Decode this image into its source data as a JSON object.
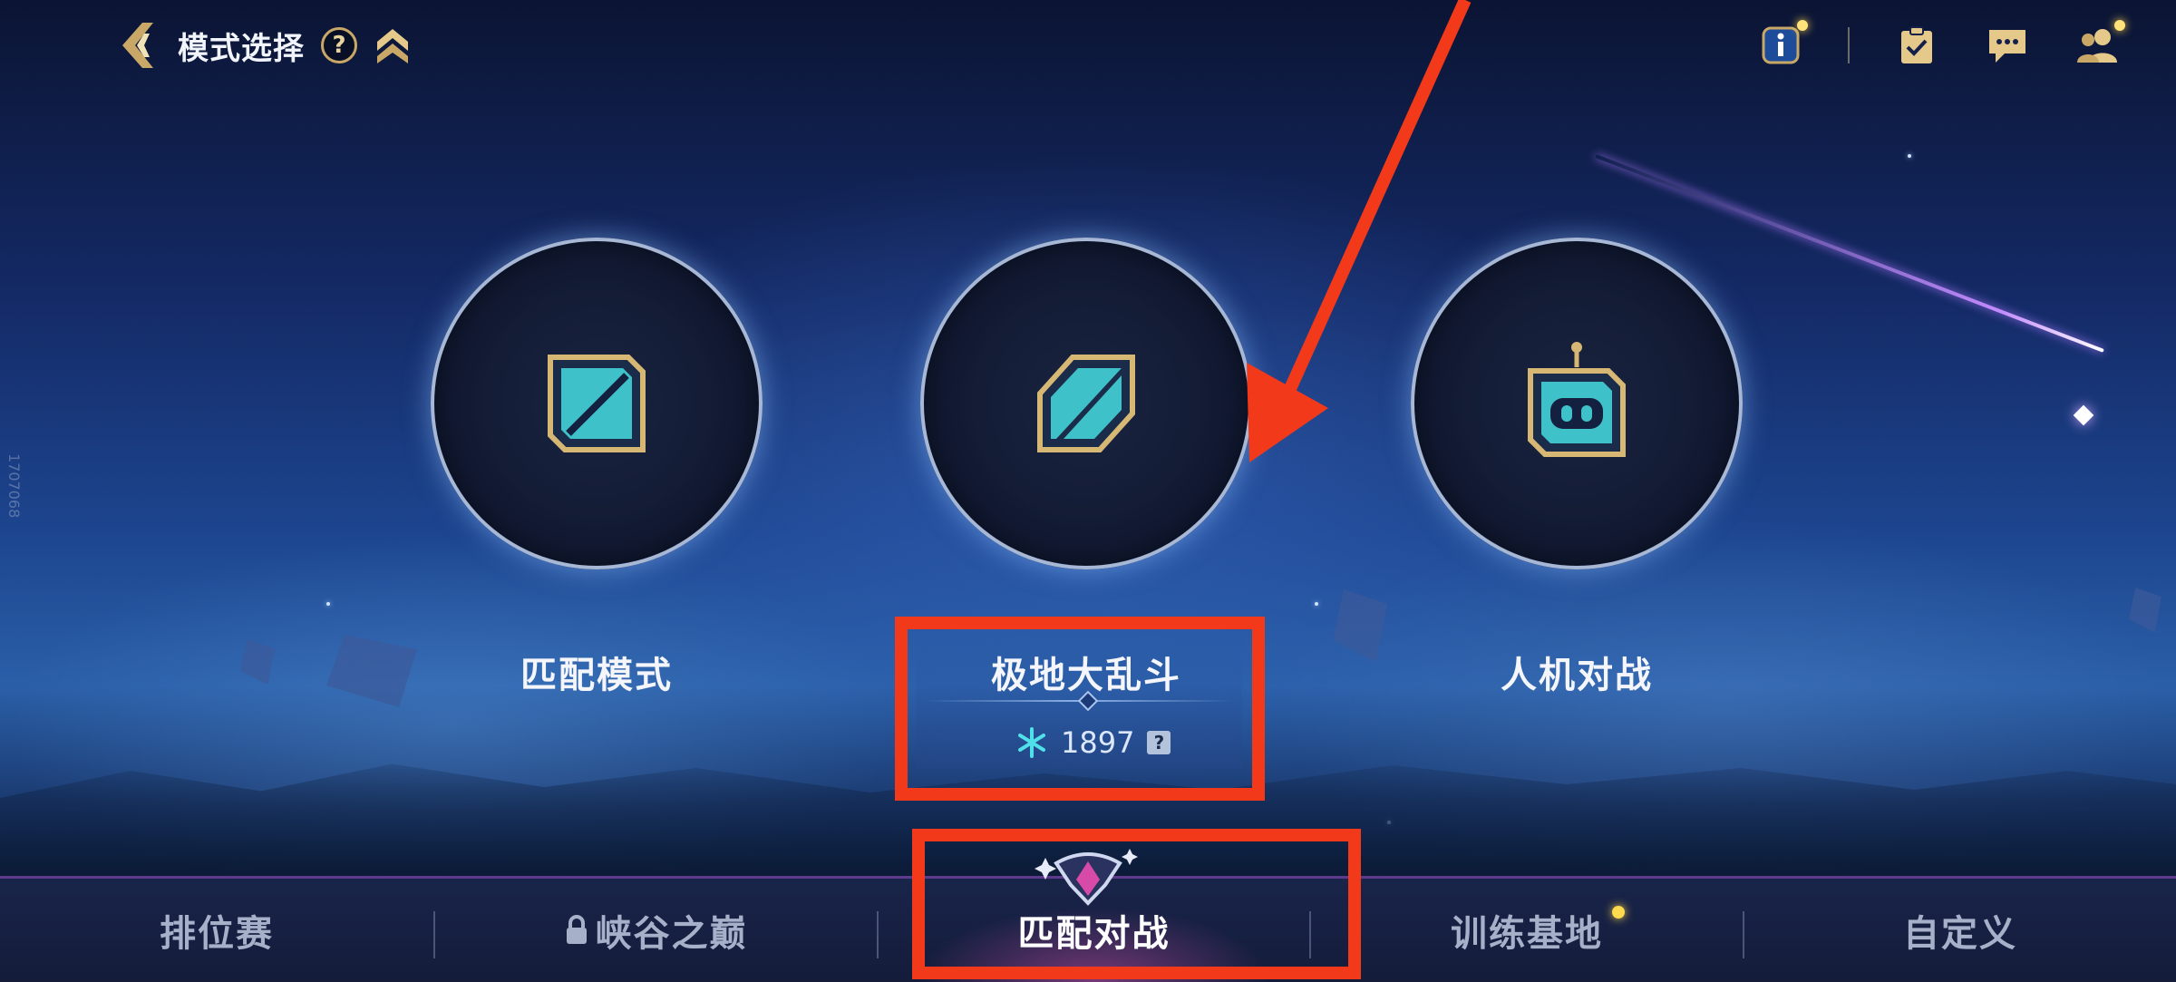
{
  "header": {
    "title": "模式选择",
    "help": "?"
  },
  "side_mark": "1707068",
  "modes": [
    {
      "label": "匹配模式"
    },
    {
      "label": "极地大乱斗"
    },
    {
      "label": "人机对战"
    }
  ],
  "aram_detail": {
    "points": "1897",
    "help": "?"
  },
  "tabs": [
    {
      "label": "排位赛"
    },
    {
      "label": "峡谷之巅"
    },
    {
      "label": "匹配对战"
    },
    {
      "label": "训练基地"
    },
    {
      "label": "自定义"
    }
  ],
  "colors": {
    "accent_gold": "#c9a867",
    "annotation_red": "#f23a1b",
    "icon_teal": "#3fc1c9"
  }
}
